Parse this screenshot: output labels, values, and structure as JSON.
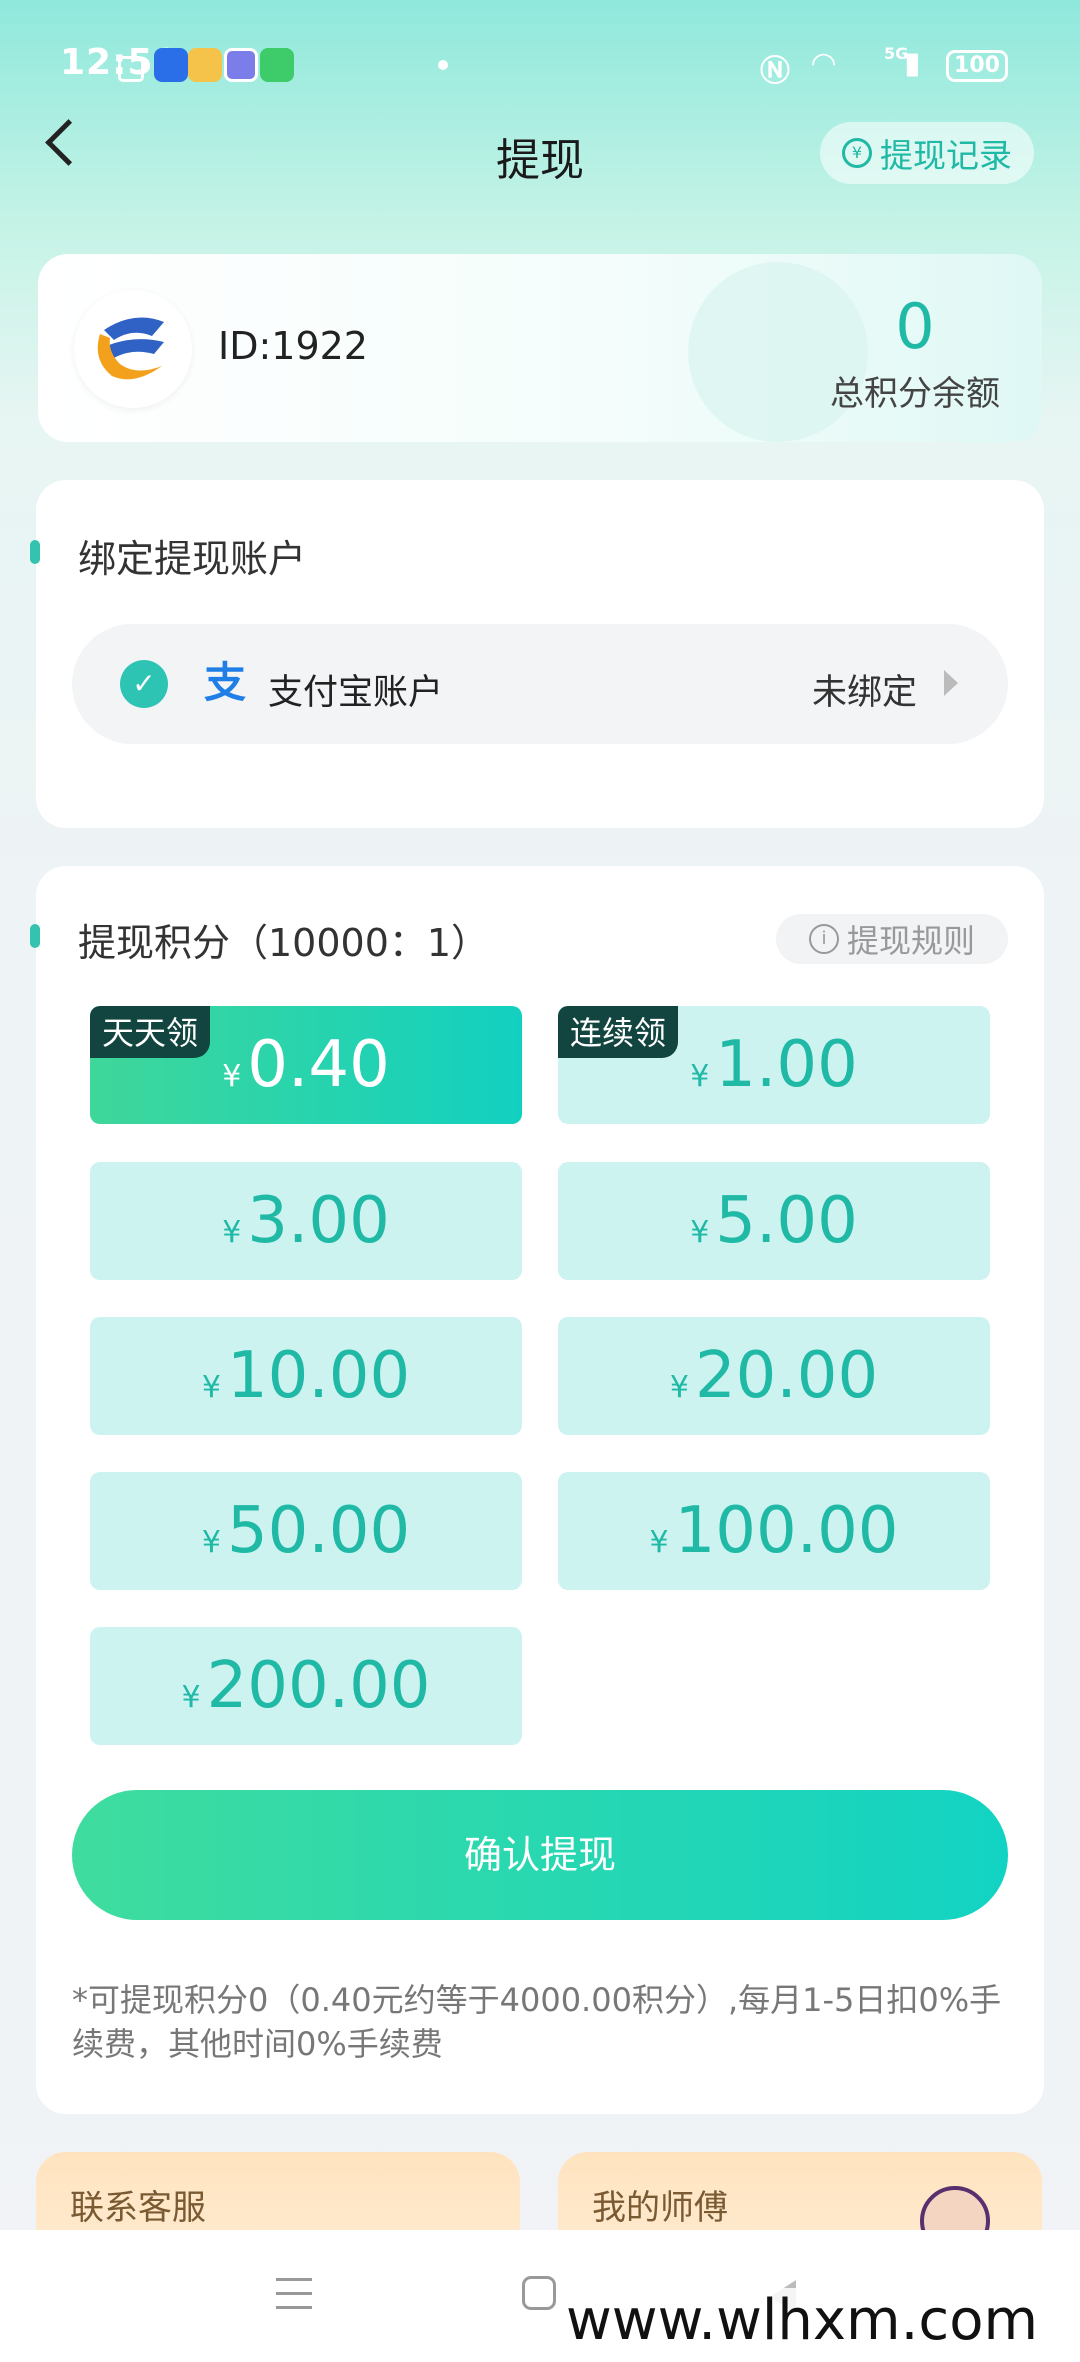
{
  "status_bar": {
    "time": "12:50",
    "battery": "100",
    "signal": "5G"
  },
  "header": {
    "title": "提现",
    "record_label": "提现记录"
  },
  "profile": {
    "id_text": "ID:1922",
    "points_value": "0",
    "points_label": "总积分余额"
  },
  "bind_section": {
    "title": "绑定提现账户",
    "account_label": "支付宝账户",
    "status": "未绑定"
  },
  "withdraw_section": {
    "title": "提现积分（10000：1）",
    "rule_label": "提现规则",
    "currency_symbol": "¥",
    "options": [
      {
        "amount": "0.40",
        "tag": "天天领",
        "selected": true
      },
      {
        "amount": "1.00",
        "tag": "连续领",
        "selected": false
      },
      {
        "amount": "3.00",
        "tag": "",
        "selected": false
      },
      {
        "amount": "5.00",
        "tag": "",
        "selected": false
      },
      {
        "amount": "10.00",
        "tag": "",
        "selected": false
      },
      {
        "amount": "20.00",
        "tag": "",
        "selected": false
      },
      {
        "amount": "50.00",
        "tag": "",
        "selected": false
      },
      {
        "amount": "100.00",
        "tag": "",
        "selected": false
      },
      {
        "amount": "200.00",
        "tag": "",
        "selected": false
      }
    ],
    "confirm_label": "确认提现",
    "note": "*可提现积分0（0.40元约等于4000.00积分）,每月1-5日扣0%手续费，其他时间0%手续费"
  },
  "bottom_cards": {
    "service_label": "联系客服",
    "master_label": "我的师傅"
  },
  "watermark": "www.wlhxm.com",
  "colors": {
    "accent": "#1fb9a6",
    "option_bg": "#cdf3f1",
    "tag_bg": "#12453f"
  }
}
